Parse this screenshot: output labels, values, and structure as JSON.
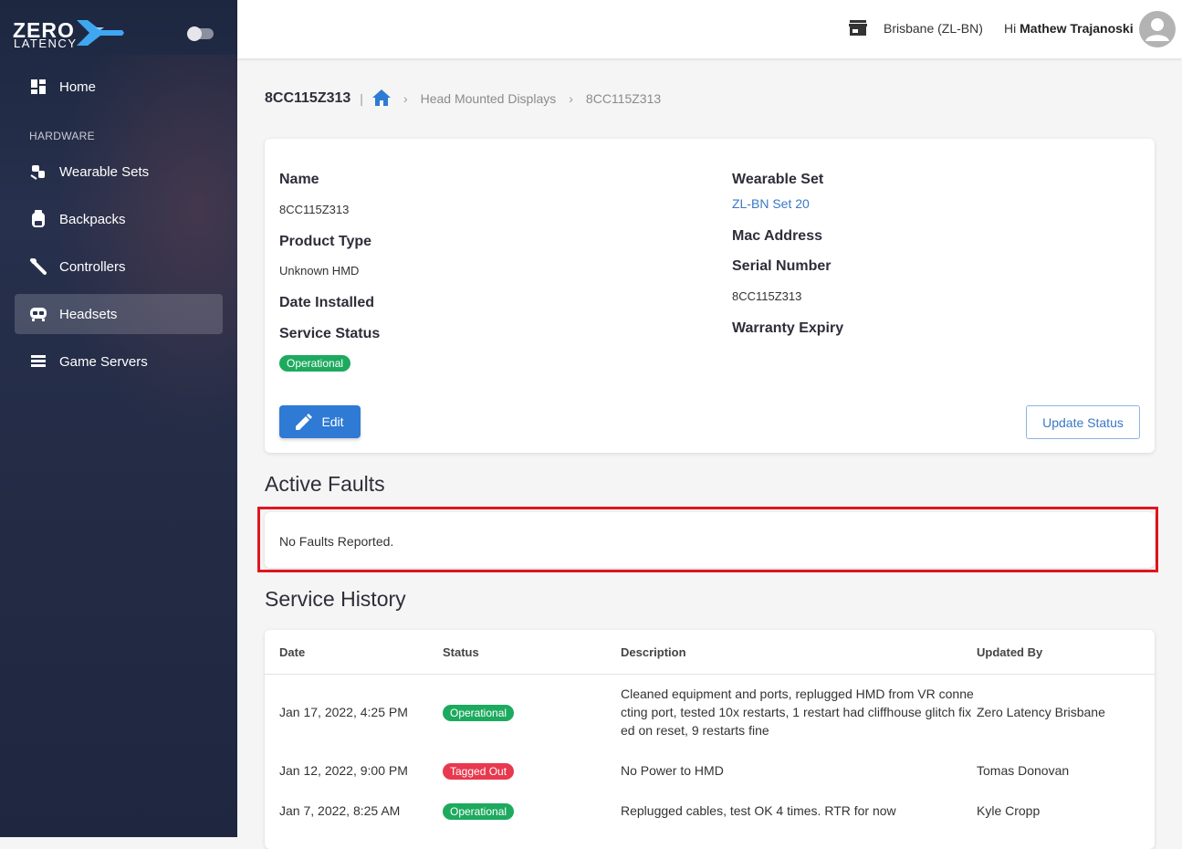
{
  "app": {
    "logo_word_1": "ZERO",
    "logo_word_2": "LATENCY",
    "accent_color": "#2e7ad4",
    "theme_toggle_icon": "toggle-icon"
  },
  "sidebar": {
    "section_label": "HARDWARE",
    "items": [
      {
        "label": "Home",
        "icon": "dashboard-icon"
      },
      {
        "label": "Wearable Sets",
        "icon": "wearable-set-icon"
      },
      {
        "label": "Backpacks",
        "icon": "backpack-icon"
      },
      {
        "label": "Controllers",
        "icon": "controller-icon"
      },
      {
        "label": "Headsets",
        "icon": "headset-icon",
        "active": true
      },
      {
        "label": "Game Servers",
        "icon": "server-icon"
      }
    ]
  },
  "header": {
    "location": "Brisbane (ZL-BN)",
    "greeting_prefix": "Hi",
    "user_name": "Mathew Trajanoski"
  },
  "breadcrumb": {
    "current_title": "8CC115Z313",
    "separator": "|",
    "items": [
      "Head Mounted Displays",
      "8CC115Z313"
    ]
  },
  "details": {
    "name_label": "Name",
    "name_value": "8CC115Z313",
    "product_type_label": "Product Type",
    "product_type_value": "Unknown HMD",
    "date_installed_label": "Date Installed",
    "service_status_label": "Service Status",
    "service_status_value": "Operational",
    "wearable_set_label": "Wearable Set",
    "wearable_set_value": "ZL-BN Set 20",
    "mac_address_label": "Mac Address",
    "serial_number_label": "Serial Number",
    "serial_number_value": "8CC115Z313",
    "warranty_expiry_label": "Warranty Expiry",
    "edit_label": "Edit",
    "update_status_label": "Update Status"
  },
  "active_faults": {
    "title": "Active Faults",
    "empty_text": "No Faults Reported."
  },
  "service_history": {
    "title": "Service History",
    "columns": [
      "Date",
      "Status",
      "Description",
      "Updated By"
    ],
    "rows": [
      {
        "date": "Jan 17, 2022, 4:25 PM",
        "status": "Operational",
        "status_color": "#1daa5f",
        "description": "Cleaned equipment and ports, replugged HMD from VR connecting port, tested 10x restarts, 1 restart had cliffhouse glitch fixed on reset, 9 restarts fine",
        "updated_by": "Zero Latency Brisbane"
      },
      {
        "date": "Jan 12, 2022, 9:00 PM",
        "status": "Tagged Out",
        "status_color": "#e8394e",
        "description": "No Power to HMD",
        "updated_by": "Tomas Donovan"
      },
      {
        "date": "Jan 7, 2022, 8:25 AM",
        "status": "Operational",
        "status_color": "#1daa5f",
        "description": "Replugged cables, test OK 4 times. RTR for now",
        "updated_by": "Kyle Cropp"
      }
    ]
  }
}
